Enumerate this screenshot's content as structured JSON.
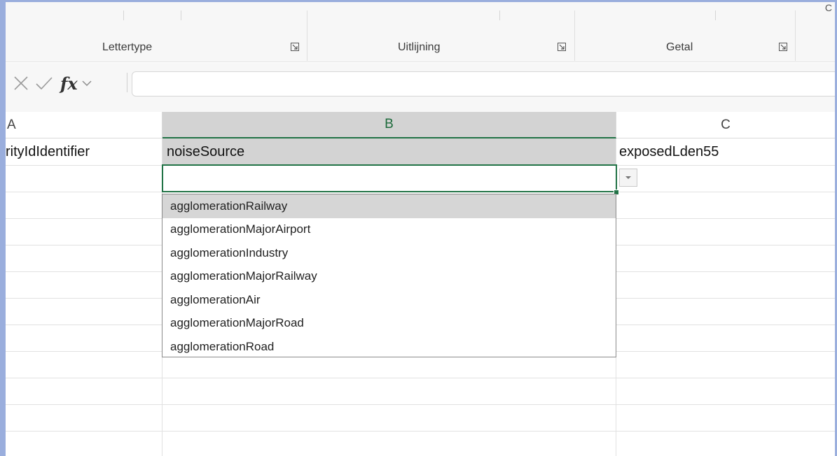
{
  "ribbon": {
    "groups": [
      {
        "label": "Lettertype"
      },
      {
        "label": "Uitlijning"
      },
      {
        "label": "Getal"
      }
    ],
    "corner_char": "C"
  },
  "formula_bar": {
    "cancel_icon": "close-icon",
    "enter_icon": "check-icon",
    "fx_label": "fx",
    "value": ""
  },
  "columns": [
    {
      "letter": "A"
    },
    {
      "letter": "B",
      "selected": true
    },
    {
      "letter": "C"
    }
  ],
  "cells": {
    "a1": "rityIdIdentifier",
    "b1": "noiseSource",
    "c1": "exposedLden55",
    "b2": ""
  },
  "dropdown": {
    "items": [
      "agglomerationRailway",
      "agglomerationMajorAirport",
      "agglomerationIndustry",
      "agglomerationMajorRailway",
      "agglomerationAir",
      "agglomerationMajorRoad",
      "agglomerationRoad"
    ],
    "highlighted_index": 0
  },
  "colors": {
    "accent": "#217346",
    "selected_header_bg": "#d3d3d3",
    "window_border": "#9aaedd"
  }
}
